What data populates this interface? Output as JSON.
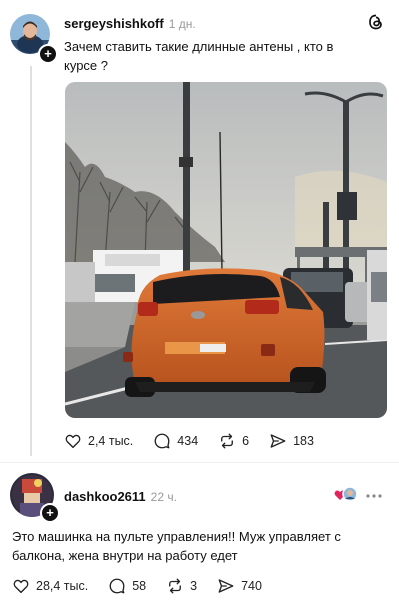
{
  "post": {
    "username": "sergeyshishkoff",
    "time": "1 дн.",
    "text": "Зачем ставить такие длинные антены , кто в курсе ?",
    "stats": {
      "likes": "2,4 тыс.",
      "comments": "434",
      "reposts": "6",
      "shares": "183"
    }
  },
  "reply": {
    "username": "dashkoo2611",
    "time": "22 ч.",
    "text": "Это машинка на пульте управления!! Муж управляет с балкона, жена внутри на работу едет",
    "stats": {
      "likes": "28,4 тыс.",
      "comments": "58",
      "reposts": "3",
      "shares": "740"
    }
  },
  "icons": [
    "threads-logo-icon",
    "heart-icon",
    "comment-icon",
    "repost-icon",
    "share-icon",
    "more-icon"
  ],
  "colors": {
    "like_heart": "#e0245e",
    "car_orange": "#d4682a"
  }
}
